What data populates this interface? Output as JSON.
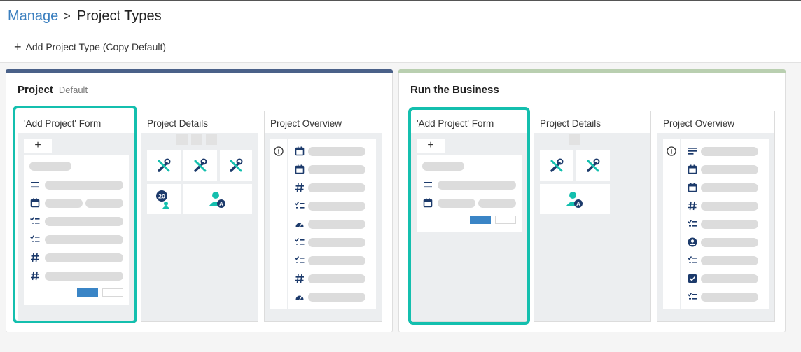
{
  "breadcrumb": {
    "parent": "Manage",
    "separator": ">",
    "current": "Project Types"
  },
  "toolbar": {
    "add_label": "Add Project Type (Copy Default)",
    "add_icon": "plus-icon"
  },
  "colors": {
    "project_bar": "#4a6189",
    "business_bar": "#b9cfb0",
    "highlight": "#14bfae",
    "icon_navy": "#1c3a6b",
    "icon_teal": "#14bfae",
    "save_blue": "#3a85c6"
  },
  "cards": [
    {
      "title": "Project",
      "subtitle": "Default",
      "panels": [
        {
          "label": "'Add Project' Form",
          "add_symbol": "+"
        },
        {
          "label": "Project Details",
          "badge_number": "20"
        },
        {
          "label": "Project Overview",
          "info_symbol": "i"
        }
      ]
    },
    {
      "title": "Run the Business",
      "subtitle": "",
      "panels": [
        {
          "label": "'Add Project' Form",
          "add_symbol": "+"
        },
        {
          "label": "Project Details"
        },
        {
          "label": "Project Overview",
          "info_symbol": "i"
        }
      ]
    }
  ]
}
